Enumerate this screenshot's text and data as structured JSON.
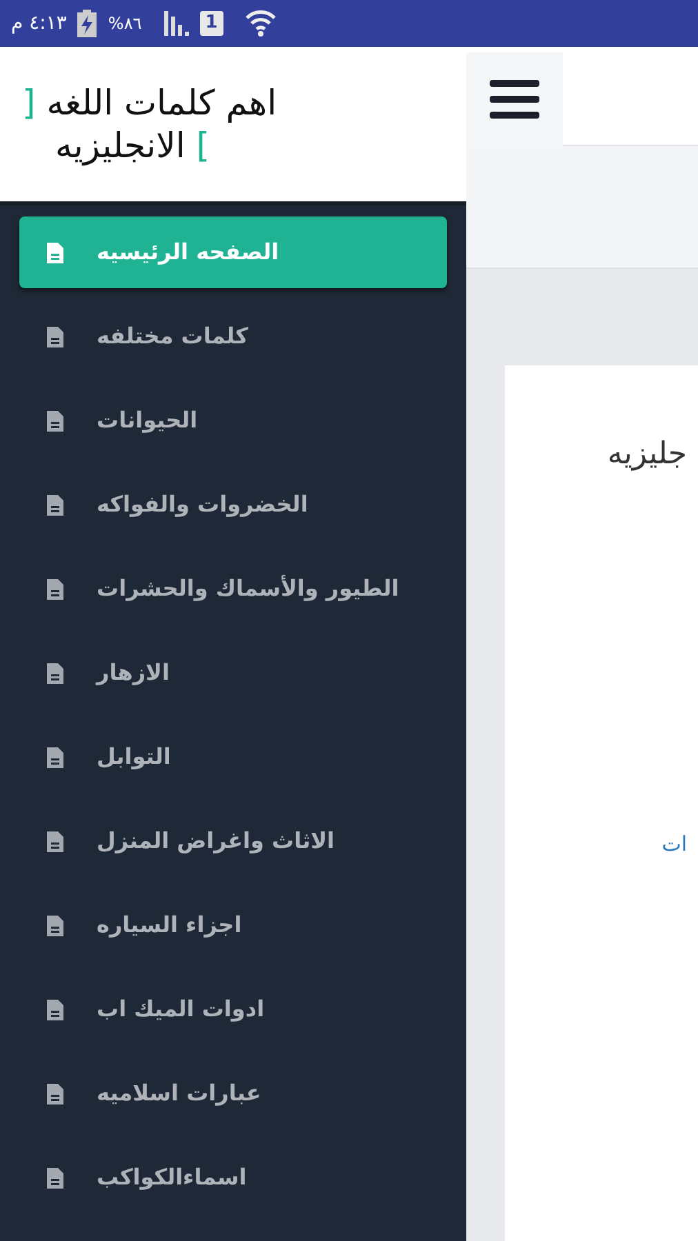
{
  "status_bar": {
    "time": "٤:١٣ م",
    "battery": "%٨٦",
    "sim": "1"
  },
  "drawer": {
    "title_lines": [
      {
        "text": "اهم كلمات اللغه",
        "bracket": "]"
      },
      {
        "text": "الانجليزيه",
        "bracket": "["
      }
    ],
    "items": [
      {
        "label": "الصفحه الرئيسيه",
        "selected": true
      },
      {
        "label": "كلمات مختلفه",
        "selected": false
      },
      {
        "label": "الحيوانات",
        "selected": false
      },
      {
        "label": "الخضروات والفواكه",
        "selected": false
      },
      {
        "label": "الطيور والأسماك والحشرات",
        "selected": false
      },
      {
        "label": "الازهار",
        "selected": false
      },
      {
        "label": "التوابل",
        "selected": false
      },
      {
        "label": "الاثاث واغراض المنزل",
        "selected": false
      },
      {
        "label": "اجزاء السياره",
        "selected": false
      },
      {
        "label": "ادوات الميك اب",
        "selected": false
      },
      {
        "label": "عبارات اسلاميه",
        "selected": false
      },
      {
        "label": "اسماءالكواكب",
        "selected": false
      }
    ]
  },
  "main": {
    "heading": "جليزيه",
    "link": "ات"
  }
}
